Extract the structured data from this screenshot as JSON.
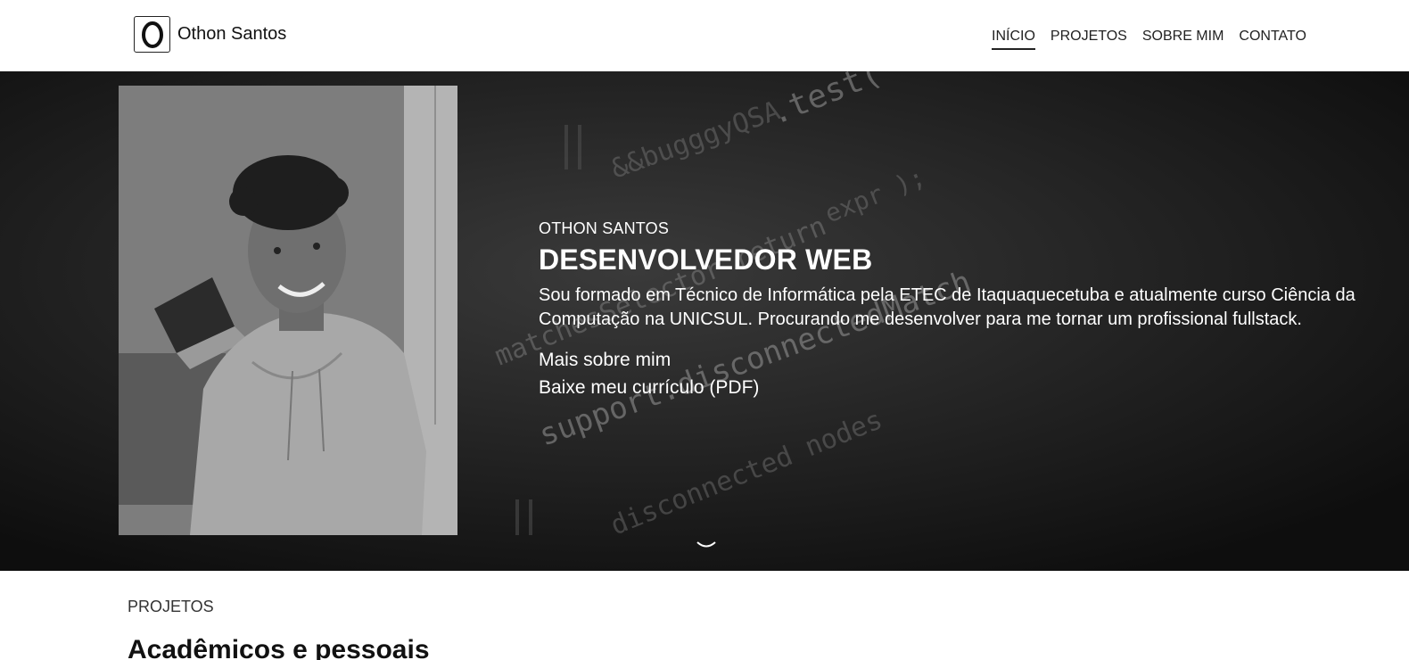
{
  "header": {
    "logo_letter": "O",
    "brand_name": "Othon Santos",
    "nav": [
      {
        "label": "INÍCIO",
        "active": true
      },
      {
        "label": "PROJETOS",
        "active": false
      },
      {
        "label": "SOBRE MIM",
        "active": false
      },
      {
        "label": "CONTATO",
        "active": false
      }
    ]
  },
  "hero": {
    "eyebrow": "OTHON SANTOS",
    "headline": "DESENVOLVEDOR WEB",
    "summary": "Sou formado em Técnico de Informática pela ETEC de Itaquaquecetuba e atualmente curso Ciência da Computação na UNICSUL. Procurando me desenvolver para me tornar um profissional fullstack.",
    "link_about": "Mais sobre mim",
    "link_resume": "Baixe meu currículo (PDF)",
    "scroll_icon": "chevron-down-icon",
    "background_code": [
      ".test( expr",
      "&&bugggyQSA",
      "matchesSelector return",
      "support.disconnectedMatch",
      "disconnected nodes",
      "expr );"
    ]
  },
  "projects": {
    "eyebrow": "PROJETOS",
    "title": "Acadêmicos e pessoais"
  },
  "colors": {
    "hero_bg": "#141414",
    "text_light": "#ffffff",
    "text_dark": "#111111"
  }
}
